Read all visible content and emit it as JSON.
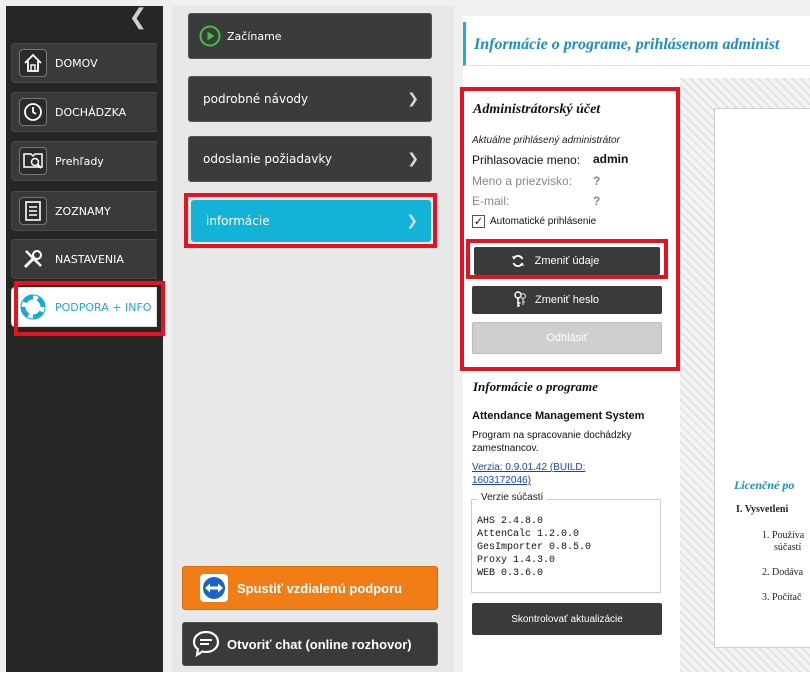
{
  "sidebar": {
    "collapse_glyph": "❮",
    "items": [
      {
        "label": "DOMOV",
        "icon": "home-icon"
      },
      {
        "label": "DOCHÁDZKA",
        "icon": "clock-icon"
      },
      {
        "label": "Prehľady",
        "icon": "report-search-icon"
      },
      {
        "label": "ZOZNAMY",
        "icon": "list-icon"
      },
      {
        "label": "NASTAVENIA",
        "icon": "tools-icon"
      },
      {
        "label": "PODPORA + INFO",
        "icon": "lifebuoy-icon"
      }
    ]
  },
  "menu": {
    "start_label": "Začíname",
    "items": [
      {
        "label": "podrobné návody"
      },
      {
        "label": "odoslanie požiadavky"
      },
      {
        "label": "informácie"
      }
    ],
    "chevron": "❯",
    "remote_support_label": "Spustiť vzdialenú podporu",
    "chat_label": "Otvoriť chat (online rozhovor)"
  },
  "page": {
    "title": "Informácie o programe, prihlásenom administ"
  },
  "admin": {
    "title": "Administrátorský účet",
    "subtitle": "Aktuálne prihlásený administrátor",
    "login_label": "Prihlasovacie meno:",
    "login_value": "admin",
    "name_label": "Meno a priezvisko:",
    "name_value": "?",
    "email_label": "E-mail:",
    "email_value": "?",
    "auto_login_label": "Automatické prihlásenie",
    "auto_login_checked": "✓",
    "change_data_label": "Zmeniť údaje",
    "change_password_label": "Zmeniť heslo",
    "logout_label": "Odhlásiť"
  },
  "program": {
    "title": "Informácie o programe",
    "name": "Attendance Management System",
    "desc_line1": "Program na spracovanie dochádzky",
    "desc_line2": "zamestnancov.",
    "version_line1": "Verzia: 0.9.01.42 (BUILD:",
    "version_line2": "1603172046)",
    "components_legend": "Verzie súčastí",
    "components": [
      "AHS 2.4.8.0",
      "AttenCalc 1.2.0.0",
      "GesImporter 0.8.5.0",
      "Proxy 1.4.3.0",
      "WEB 0.3.6.0"
    ],
    "check_updates_label": "Skontrolovať aktualizácie"
  },
  "license": {
    "title": "Licenčné po",
    "section": "I. Vysvetleni",
    "item1a": "1. Používa",
    "item1b": "súčastí",
    "item2": "2. Dodáva",
    "item3": "3. Počítač"
  },
  "colors": {
    "accent": "#12b3d6",
    "highlight": "#e5121f",
    "orange": "#f07d16"
  }
}
